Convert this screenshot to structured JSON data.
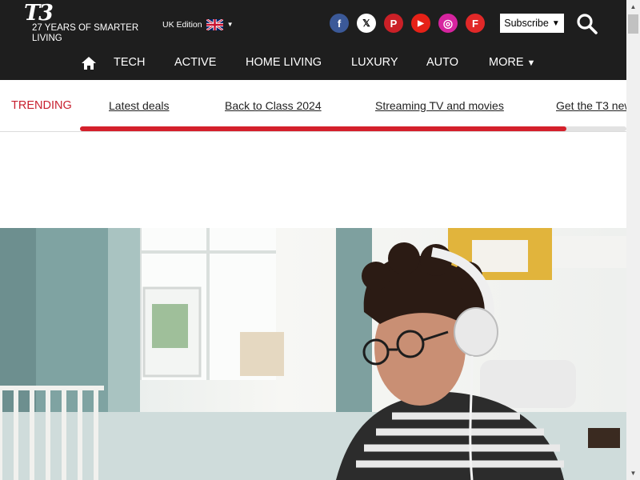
{
  "header": {
    "logo": "T3",
    "tagline": "27 YEARS OF SMARTER LIVING",
    "edition": "UK Edition",
    "edition_icon": "uk-flag-icon",
    "subscribe_label": "Subscribe",
    "social": [
      {
        "name": "facebook",
        "glyph": "f",
        "color": "#3b5998"
      },
      {
        "name": "x",
        "glyph": "𝕏",
        "color": "#ffffff"
      },
      {
        "name": "pinterest",
        "glyph": "P",
        "color": "#cb2027"
      },
      {
        "name": "youtube",
        "glyph": "▶",
        "color": "#e62117"
      },
      {
        "name": "instagram",
        "glyph": "◎",
        "color": "#d6249f"
      },
      {
        "name": "flipboard",
        "glyph": "F",
        "color": "#e12828"
      }
    ]
  },
  "nav": {
    "items": [
      "TECH",
      "ACTIVE",
      "HOME LIVING",
      "LUXURY",
      "AUTO",
      "MORE"
    ]
  },
  "trending": {
    "label": "TRENDING",
    "links": [
      "Latest deals",
      "Back to Class 2024",
      "Streaming TV and movies",
      "Get the T3 new"
    ],
    "scroll_progress": 0.89
  },
  "hero": {
    "description_icon": "hero-photo-man-with-headphones"
  },
  "colors": {
    "header_bg": "#1e1e1e",
    "accent": "#d4202b",
    "trending": "#c8202f"
  }
}
